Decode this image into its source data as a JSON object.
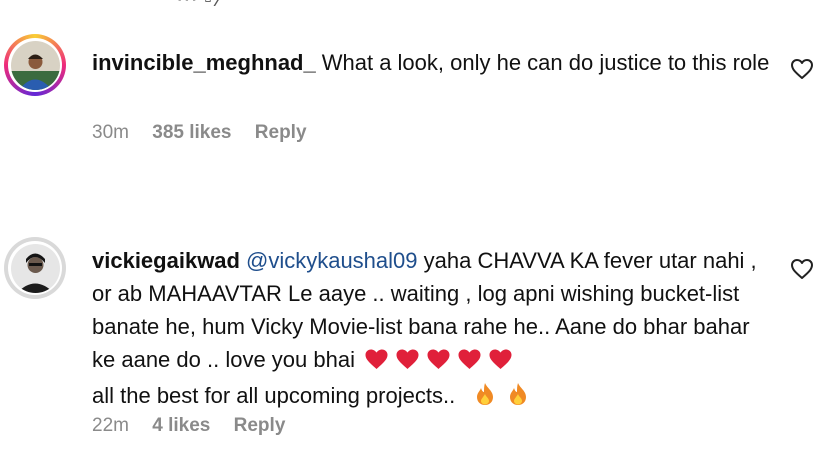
{
  "comments": [
    {
      "username": "invincible_meghnad_",
      "text": "What a look, only he can do justice to this role",
      "time": "30m",
      "likes": "385 likes",
      "reply_label": "Reply",
      "avatar_icon": "profile-photo"
    },
    {
      "username": "vickiegaikwad",
      "mention": "@vickykaushal09",
      "text_line1": "yaha CHAVVA KA fever utar nahi , or ab MAHAAVTAR Le aaye .. waiting , log apni wishing bucket-list banate he, hum Vicky Movie-list bana rahe he.. Aane do bhar bahar ke aane do .. love you bhai",
      "text_line2": "all the best for all upcoming projects..",
      "time": "22m",
      "likes": "4 likes",
      "reply_label": "Reply",
      "avatar_icon": "profile-photo",
      "emoji_hearts": 5,
      "emoji_fires": 2
    }
  ],
  "colors": {
    "heart_emoji": "#e0203a",
    "fire_emoji": "#f08a24",
    "mention": "#1f4e8c",
    "meta_text": "#8a8a8a"
  }
}
